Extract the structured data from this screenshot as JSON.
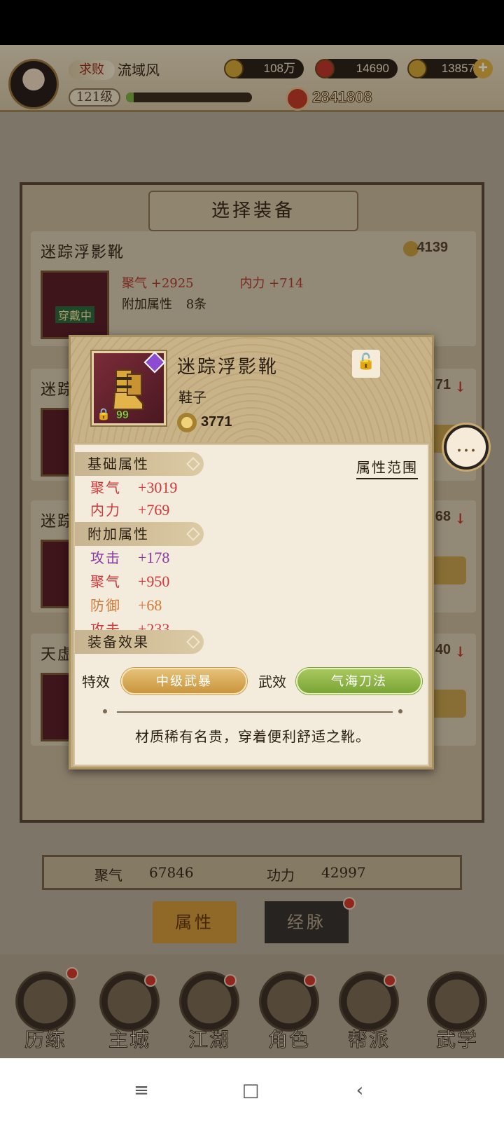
{
  "player": {
    "rank": "求败",
    "name": "流域风",
    "level": "121级",
    "exp_fraction": 0.06,
    "power": "2841808"
  },
  "resources": {
    "coins": "108万",
    "ingots_a": "14690",
    "ingots_b": "13857"
  },
  "select_panel": {
    "title": "选择装备",
    "cards": [
      {
        "name": "迷踪浮影靴",
        "power": "4139",
        "tag": "穿戴中",
        "stat_1_label": "聚气",
        "stat_1_value": "+2925",
        "stat_2_label": "内力",
        "stat_2_value": "+714",
        "extra_label": "附加属性",
        "extra_count": "8条"
      },
      {
        "name": "迷踪",
        "power": "71",
        "arrow": "↓"
      },
      {
        "name": "迷踪",
        "power": "68",
        "arrow": "↓"
      },
      {
        "name": "天虚",
        "power": "40",
        "arrow": "↓"
      }
    ]
  },
  "bottom_stats": {
    "stat_1_label": "聚气",
    "stat_1_value": "67846",
    "stat_2_label": "功力",
    "stat_2_value": "42997"
  },
  "tabs": {
    "attributes": "属性",
    "meridians": "经脉"
  },
  "nav": {
    "items": [
      "历练",
      "主城",
      "江湖",
      "角色",
      "帮派",
      "武学"
    ]
  },
  "modal": {
    "item_name": "迷踪浮影靴",
    "item_type": "鞋子",
    "item_level": "99",
    "item_power": "3771",
    "range_link": "属性范围",
    "base_section": "基础属性",
    "base_stats": [
      {
        "label": "聚气",
        "value": "+3019"
      },
      {
        "label": "内力",
        "value": "+769"
      }
    ],
    "extra_section": "附加属性",
    "extra_stats": [
      {
        "label": "攻击",
        "value": "+178"
      },
      {
        "label": "聚气",
        "value": "+950"
      },
      {
        "label": "防御",
        "value": "+68"
      },
      {
        "label": "攻击",
        "value": "+233"
      }
    ],
    "effect_section": "装备效果",
    "special_label": "特效",
    "special_value": "中级武暴",
    "martial_label": "武效",
    "martial_value": "气海刀法",
    "description": "材质稀有名贵，穿着便利舒适之靴。"
  },
  "colors": {
    "stat_red": "#d1373a",
    "stat_purple": "#8a3aa0",
    "stat_orange": "#d2783a",
    "pill_gold": "#c9953d",
    "pill_green": "#7aa436"
  },
  "system_nav": {
    "menu_icon": "menu-icon",
    "home_icon": "home-icon",
    "back_icon": "back-icon"
  }
}
